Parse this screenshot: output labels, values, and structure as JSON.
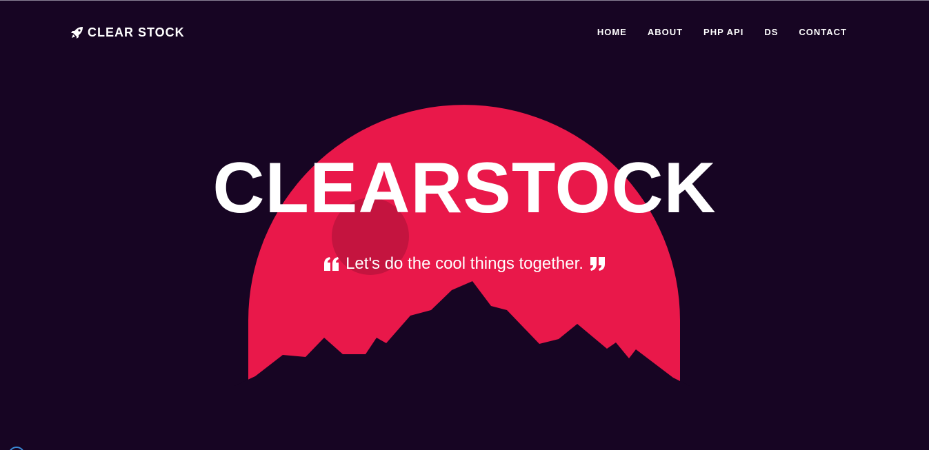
{
  "brand": {
    "label": "CLEAR STOCK",
    "icon": "rocket-icon"
  },
  "nav": {
    "items": [
      {
        "label": "HOME"
      },
      {
        "label": "ABOUT"
      },
      {
        "label": "PHP API"
      },
      {
        "label": "DS"
      },
      {
        "label": "CONTACT"
      }
    ]
  },
  "hero": {
    "title": "CLEARSTOCK",
    "quote": "Let's do the cool things together.",
    "open_quote_icon": "quote-left-icon",
    "close_quote_icon": "quote-right-icon"
  },
  "colors": {
    "background": "#170523",
    "sun": "#e9184a",
    "sun_spot": "#c4143f",
    "mountain": "#170523",
    "text": "#ffffff"
  }
}
